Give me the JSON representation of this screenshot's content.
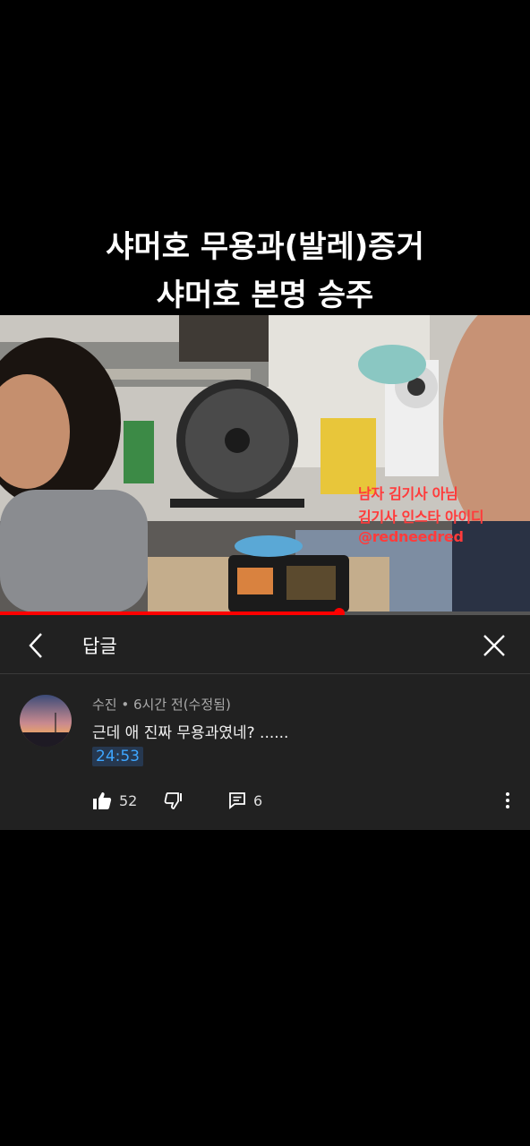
{
  "caption": {
    "line1": "샤머호 무용과(발레)증거",
    "line2": "샤머호 본명 승주"
  },
  "video": {
    "overlay_line1": "남자 김기사 아님",
    "overlay_line2": "김기사 인스타 아이디",
    "overlay_line3": "@redneedred",
    "progress_fraction": 0.64,
    "accent_color": "#ff0000"
  },
  "replies_panel": {
    "title": "답글",
    "back_icon": "chevron-left-icon",
    "close_icon": "close-icon"
  },
  "comment": {
    "meta": "수진 • 6시간 전(수정됨)",
    "text": "근데 애 진짜 무용과였네? ......",
    "timestamp": "24:53",
    "like_count": "52",
    "reply_count": "6",
    "icons": [
      "thumb-up-icon",
      "thumb-down-icon",
      "reply-icon",
      "more-vert-icon"
    ]
  }
}
